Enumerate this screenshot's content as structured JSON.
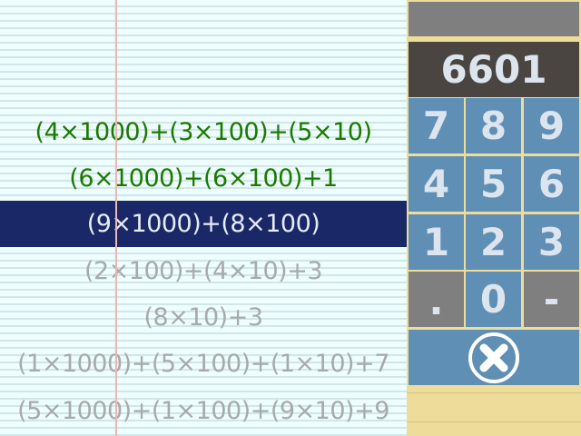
{
  "problems": [
    {
      "text": "(4×1000)+(3×100)+(5×10)",
      "state": "done"
    },
    {
      "text": "(6×1000)+(6×100)+1",
      "state": "done"
    },
    {
      "text": "(9×1000)+(8×100)",
      "state": "current"
    },
    {
      "text": "(2×100)+(4×10)+3",
      "state": "todo"
    },
    {
      "text": "(8×10)+3",
      "state": "todo"
    },
    {
      "text": "(1×1000)+(5×100)+(1×10)+7",
      "state": "todo"
    },
    {
      "text": "(5×1000)+(1×100)+(9×10)+9",
      "state": "todo"
    }
  ],
  "keypad": {
    "display": "6601",
    "keys": [
      "7",
      "8",
      "9",
      "4",
      "5",
      "6",
      "1",
      "2",
      "3",
      ".",
      "0",
      "-"
    ],
    "clear_icon": "circle-x-icon"
  },
  "colors": {
    "done": "#1a7a00",
    "current_bg": "#1a2868",
    "todo": "#a6aaaa",
    "key": "#5f8fb5"
  }
}
